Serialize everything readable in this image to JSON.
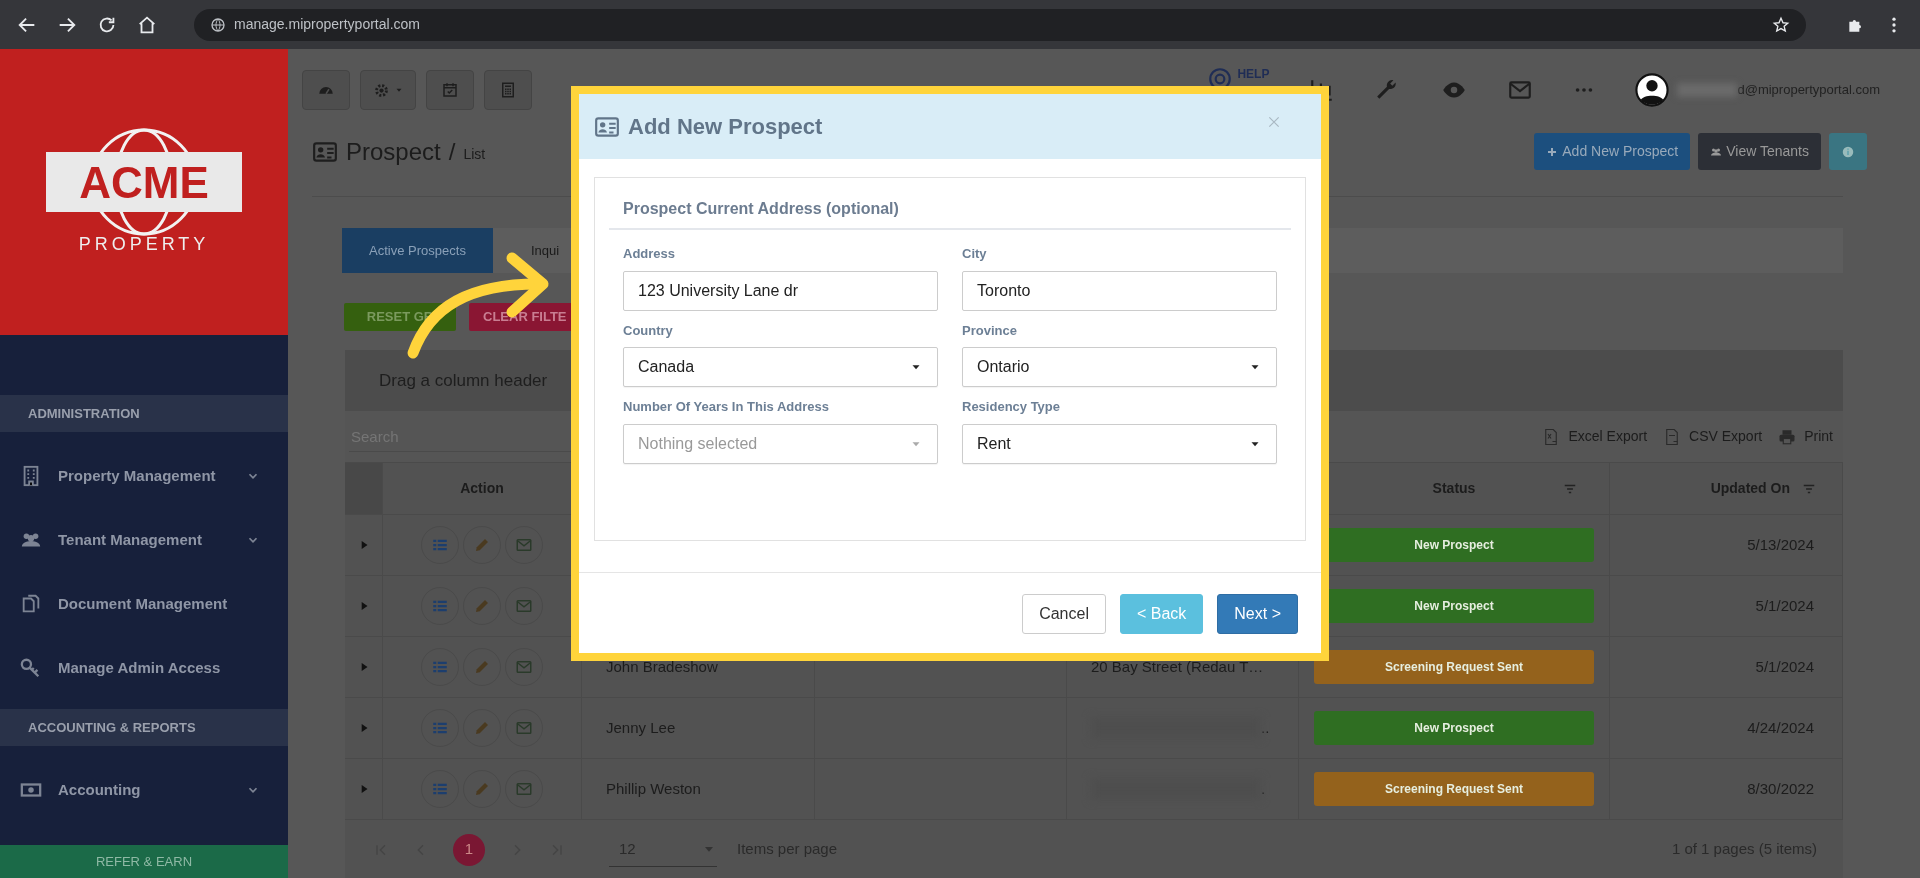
{
  "browser": {
    "url": "manage.mipropertyportal.com"
  },
  "sidebar": {
    "logo": {
      "name": "ACME",
      "tagline": "PROPERTY"
    },
    "sections": [
      {
        "title": "ADMINISTRATION",
        "items": [
          {
            "label": "Property Management",
            "expandable": true
          },
          {
            "label": "Tenant Management",
            "expandable": true
          },
          {
            "label": "Document Management",
            "expandable": false
          },
          {
            "label": "Manage Admin Access",
            "expandable": false
          }
        ]
      },
      {
        "title": "ACCOUNTING & REPORTS",
        "items": [
          {
            "label": "Accounting",
            "expandable": true
          }
        ]
      }
    ],
    "refer_button": "REFER & EARN"
  },
  "toolbar": {
    "help_label": "HELP",
    "user_email": "d@mipropertyportal.com"
  },
  "page": {
    "title": "Prospect",
    "separator": "/",
    "subtitle": "List",
    "buttons": [
      {
        "label": "Add New Prospect",
        "kind": "primary"
      },
      {
        "label": "View Tenants",
        "kind": "dark"
      }
    ]
  },
  "tabs": [
    {
      "label": "Active Prospects",
      "selected": true
    },
    {
      "label": "Inqui",
      "selected": false
    }
  ],
  "grid_buttons": [
    {
      "label": "RESET GR",
      "kind": "success"
    },
    {
      "label": "CLEAR FILTE",
      "kind": "danger"
    }
  ],
  "grid": {
    "group_hint": "Drag a column header",
    "search": {
      "placeholder": "Search"
    },
    "exports": [
      "Excel Export",
      "CSV Export",
      "Print"
    ],
    "columns": [
      {
        "label": "Action",
        "filterable": false
      },
      {
        "label": "Status",
        "filterable": true
      },
      {
        "label": "Updated On",
        "filterable": true
      }
    ],
    "rows": [
      {
        "status": "New Prospect",
        "color": "#2f6e22",
        "updated": "5/13/2024"
      },
      {
        "status": "New Prospect",
        "color": "#2f6e22",
        "updated": "5/1/2024"
      },
      {
        "name": "John Bradeshow",
        "address": "20 Bay Street (Redau T…",
        "status": "Screening Request Sent",
        "color": "#94621c",
        "updated": "5/1/2024"
      },
      {
        "name": "Jenny Lee",
        "address_redacted": true,
        "address": "..",
        "status": "New Prospect",
        "color": "#2f6e22",
        "updated": "4/24/2024"
      },
      {
        "name": "Phillip Weston",
        "address_redacted": true,
        "address": ".",
        "status": "Screening Request Sent",
        "color": "#94621c",
        "updated": "8/30/2022"
      }
    ],
    "pager": {
      "pages": [
        {
          "label": "1",
          "selected": true
        }
      ],
      "page_size": "12",
      "page_size_label": "Items per page",
      "summary": "1 of 1 pages (5 items)"
    }
  },
  "modal": {
    "title": "Add New Prospect",
    "section_title": "Prospect Current Address (optional)",
    "fields": [
      {
        "label": "Address",
        "kind": "text",
        "value": "123 University Lane dr"
      },
      {
        "label": "City",
        "kind": "text",
        "value": "Toronto"
      },
      {
        "label": "Country",
        "kind": "select",
        "value": "Canada"
      },
      {
        "label": "Province",
        "kind": "select",
        "value": "Ontario"
      },
      {
        "label": "Number Of Years In This Address",
        "kind": "select",
        "placeholder": "Nothing selected"
      },
      {
        "label": "Residency Type",
        "kind": "select",
        "value": "Rent"
      }
    ],
    "buttons": [
      {
        "label": "Cancel",
        "kind": "default"
      },
      {
        "label": "< Back",
        "kind": "info"
      },
      {
        "label": "Next >",
        "kind": "primary"
      }
    ]
  }
}
